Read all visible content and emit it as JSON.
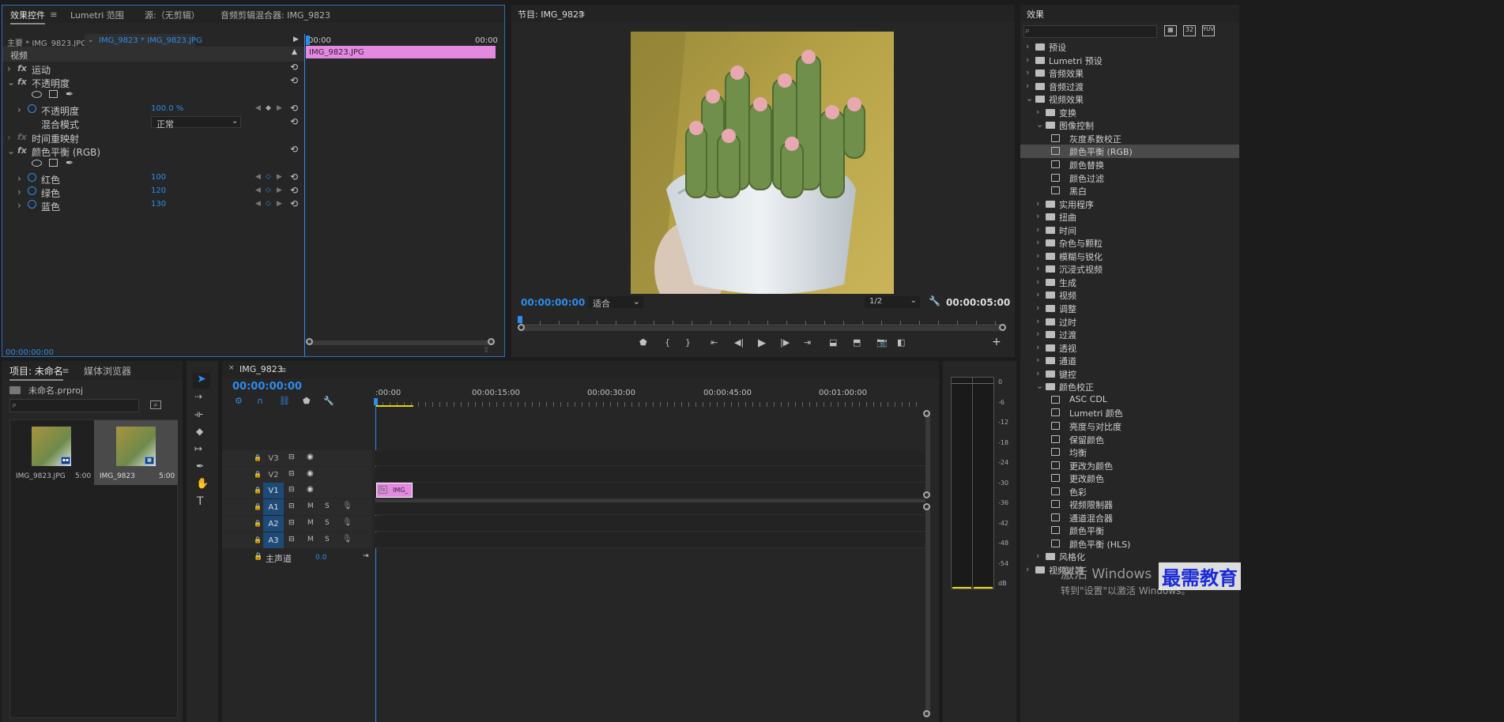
{
  "effect_controls": {
    "tabs": [
      "效果控件",
      "Lumetri 范围",
      "源:（无剪辑）",
      "音频剪辑混合器: IMG_9823"
    ],
    "master_label": "主要 * IMG_9823.JPG",
    "clip_label": "IMG_9823 * IMG_9823.JPG",
    "time_start": "00:00",
    "time_end": "00:00",
    "clip_bar_label": "IMG_9823.JPG",
    "section_video": "视频",
    "motion": "运动",
    "opacity": "不透明度",
    "opacity_param": "不透明度",
    "opacity_value": "100.0 %",
    "blend_mode_label": "混合模式",
    "blend_mode_value": "正常",
    "time_remap": "时间重映射",
    "color_balance": "颜色平衡 (RGB)",
    "red_label": "红色",
    "red_value": "100",
    "green_label": "绿色",
    "green_value": "120",
    "blue_label": "蓝色",
    "blue_value": "130",
    "footer_time": "00:00:00:00"
  },
  "program": {
    "title": "节目: IMG_9823",
    "current_time": "00:00:00:00",
    "zoom": "适合",
    "resolution": "1/2",
    "duration": "00:00:05:00"
  },
  "effects": {
    "title": "效果",
    "items": [
      {
        "label": "预设",
        "level": 0,
        "type": "folder",
        "open": false
      },
      {
        "label": "Lumetri 预设",
        "level": 0,
        "type": "folder",
        "open": false
      },
      {
        "label": "音频效果",
        "level": 0,
        "type": "folder",
        "open": false
      },
      {
        "label": "音频过渡",
        "level": 0,
        "type": "folder",
        "open": false
      },
      {
        "label": "视频效果",
        "level": 0,
        "type": "folder",
        "open": true
      },
      {
        "label": "变换",
        "level": 1,
        "type": "folder",
        "open": false
      },
      {
        "label": "图像控制",
        "level": 1,
        "type": "folder",
        "open": true
      },
      {
        "label": "灰度系数校正",
        "level": 2,
        "type": "fx"
      },
      {
        "label": "颜色平衡 (RGB)",
        "level": 2,
        "type": "fx",
        "selected": true
      },
      {
        "label": "颜色替换",
        "level": 2,
        "type": "fx"
      },
      {
        "label": "颜色过滤",
        "level": 2,
        "type": "fx"
      },
      {
        "label": "黑白",
        "level": 2,
        "type": "fx"
      },
      {
        "label": "实用程序",
        "level": 1,
        "type": "folder",
        "open": false
      },
      {
        "label": "扭曲",
        "level": 1,
        "type": "folder",
        "open": false
      },
      {
        "label": "时间",
        "level": 1,
        "type": "folder",
        "open": false
      },
      {
        "label": "杂色与颗粒",
        "level": 1,
        "type": "folder",
        "open": false
      },
      {
        "label": "模糊与锐化",
        "level": 1,
        "type": "folder",
        "open": false
      },
      {
        "label": "沉浸式视频",
        "level": 1,
        "type": "folder",
        "open": false
      },
      {
        "label": "生成",
        "level": 1,
        "type": "folder",
        "open": false
      },
      {
        "label": "视频",
        "level": 1,
        "type": "folder",
        "open": false
      },
      {
        "label": "调整",
        "level": 1,
        "type": "folder",
        "open": false
      },
      {
        "label": "过时",
        "level": 1,
        "type": "folder",
        "open": false
      },
      {
        "label": "过渡",
        "level": 1,
        "type": "folder",
        "open": false
      },
      {
        "label": "透视",
        "level": 1,
        "type": "folder",
        "open": false
      },
      {
        "label": "通道",
        "level": 1,
        "type": "folder",
        "open": false
      },
      {
        "label": "键控",
        "level": 1,
        "type": "folder",
        "open": false
      },
      {
        "label": "颜色校正",
        "level": 1,
        "type": "folder",
        "open": true
      },
      {
        "label": "ASC CDL",
        "level": 2,
        "type": "fx"
      },
      {
        "label": "Lumetri 颜色",
        "level": 2,
        "type": "fx"
      },
      {
        "label": "亮度与对比度",
        "level": 2,
        "type": "fx"
      },
      {
        "label": "保留颜色",
        "level": 2,
        "type": "fx"
      },
      {
        "label": "均衡",
        "level": 2,
        "type": "fx"
      },
      {
        "label": "更改为颜色",
        "level": 2,
        "type": "fx"
      },
      {
        "label": "更改颜色",
        "level": 2,
        "type": "fx"
      },
      {
        "label": "色彩",
        "level": 2,
        "type": "fx"
      },
      {
        "label": "视频限制器",
        "level": 2,
        "type": "fx"
      },
      {
        "label": "通道混合器",
        "level": 2,
        "type": "fx"
      },
      {
        "label": "颜色平衡",
        "level": 2,
        "type": "fx"
      },
      {
        "label": "颜色平衡 (HLS)",
        "level": 2,
        "type": "fx"
      },
      {
        "label": "风格化",
        "level": 1,
        "type": "folder",
        "open": false
      },
      {
        "label": "视频过渡",
        "level": 0,
        "type": "folder",
        "open": false
      }
    ]
  },
  "project": {
    "tabs": [
      "项目: 未命名",
      "媒体浏览器"
    ],
    "file": "未命名.prproj",
    "clips": [
      {
        "name": "IMG_9823.JPG",
        "duration": "5:00"
      },
      {
        "name": "IMG_9823",
        "duration": "5:00"
      }
    ]
  },
  "timeline": {
    "title": "IMG_9823",
    "current_time": "00:00:00:00",
    "ruler": [
      ":00:00",
      "00:00:15:00",
      "00:00:30:00",
      "00:00:45:00",
      "00:01:00:00"
    ],
    "tracks": [
      {
        "name": "V3",
        "kind": "video"
      },
      {
        "name": "V2",
        "kind": "video"
      },
      {
        "name": "V1",
        "kind": "video",
        "active": true
      },
      {
        "name": "A1",
        "kind": "audio",
        "active": true
      },
      {
        "name": "A2",
        "kind": "audio",
        "active": true
      },
      {
        "name": "A3",
        "kind": "audio",
        "active": true
      }
    ],
    "clip_label": "IMG_",
    "master_label": "主声道",
    "master_value": "0.0",
    "mute": "M",
    "solo": "S"
  },
  "meter": {
    "ticks": [
      "0",
      "-6",
      "-12",
      "-18",
      "-24",
      "-30",
      "-36",
      "-42",
      "-48",
      "-54",
      "dB"
    ]
  },
  "watermark": {
    "line1": "激活 Windows",
    "line2": "转到\"设置\"以激活 Windows。",
    "brand": "最需教育"
  }
}
